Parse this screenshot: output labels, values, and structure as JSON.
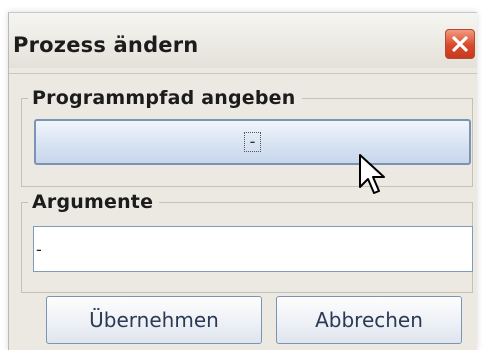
{
  "window": {
    "title": "Prozess ändern"
  },
  "titlebar": {
    "close_icon": "close-icon"
  },
  "path_group": {
    "legend": "Programmpfad angeben",
    "button_value": "-"
  },
  "args_group": {
    "legend": "Argumente",
    "input_value": "-"
  },
  "buttons": {
    "apply_label": "Übernehmen",
    "cancel_label": "Abbrechen"
  },
  "colors": {
    "window_bg": "#ebe9e2",
    "close_button": "#d9482b",
    "button_border": "#7b94b5",
    "button_text": "#2b3a55"
  }
}
